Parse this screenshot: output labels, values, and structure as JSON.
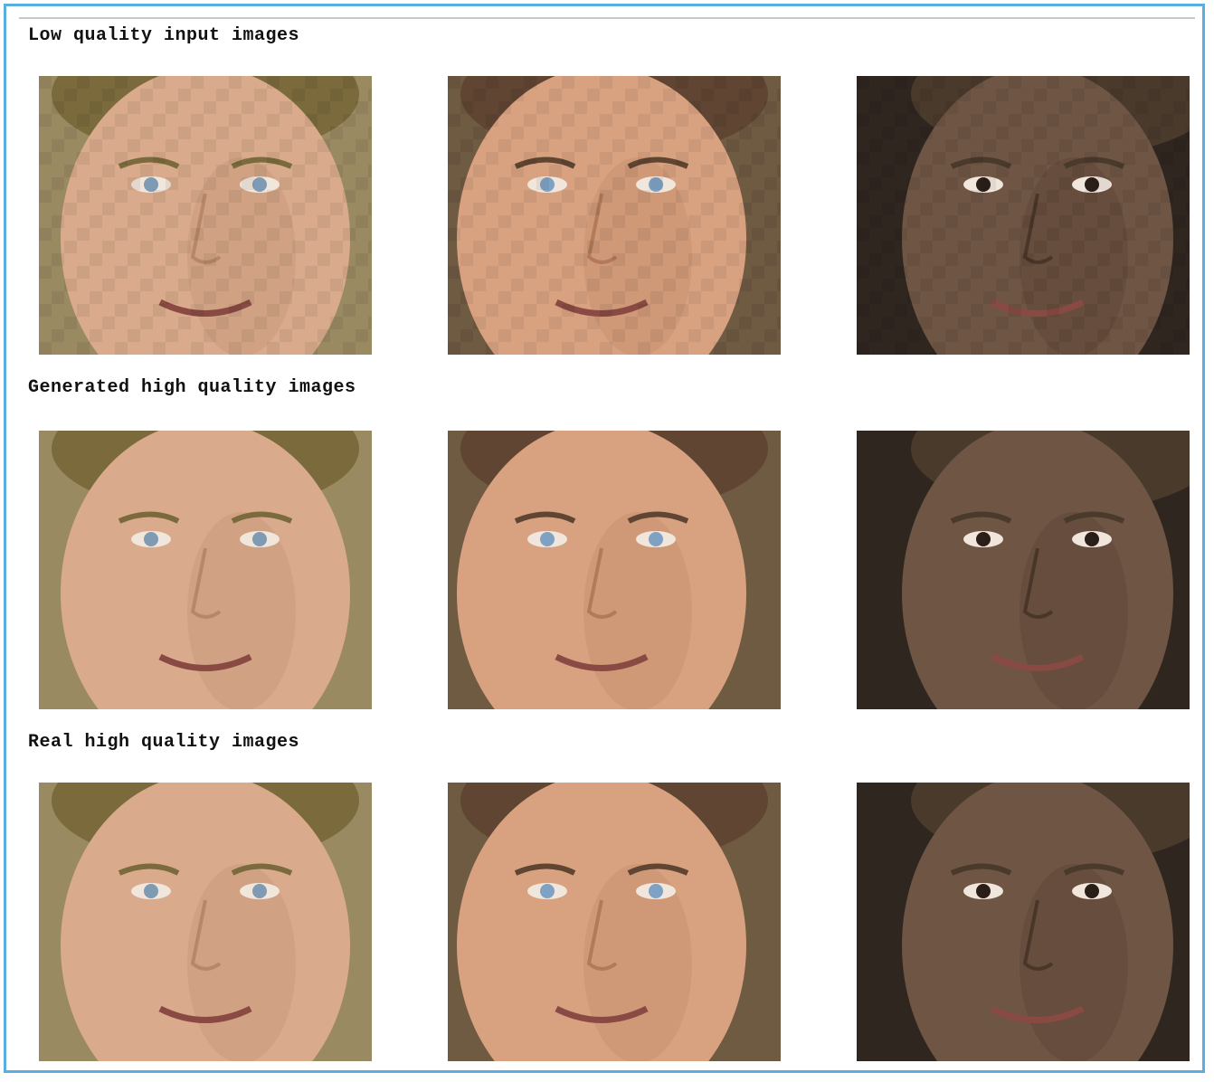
{
  "sections": [
    {
      "title": "Low quality input images",
      "quality": "low"
    },
    {
      "title": "Generated high quality images",
      "quality": "generated"
    },
    {
      "title": "Real high quality images",
      "quality": "real"
    }
  ],
  "subjects": [
    {
      "bg": "#9a8a62",
      "skin": "#d9ab8c",
      "hair": "#7a6a3c",
      "eyes": "#7f9bb4",
      "shade": "#b78868"
    },
    {
      "bg": "#6f5a42",
      "skin": "#d8a281",
      "hair": "#5f4532",
      "eyes": "#7fa2c4",
      "shade": "#b27a5a"
    },
    {
      "bg": "#2f2620",
      "skin": "#6f5544",
      "hair": "#4a3a2c",
      "eyes": "#2a1e18",
      "shade": "#4a3628"
    }
  ]
}
